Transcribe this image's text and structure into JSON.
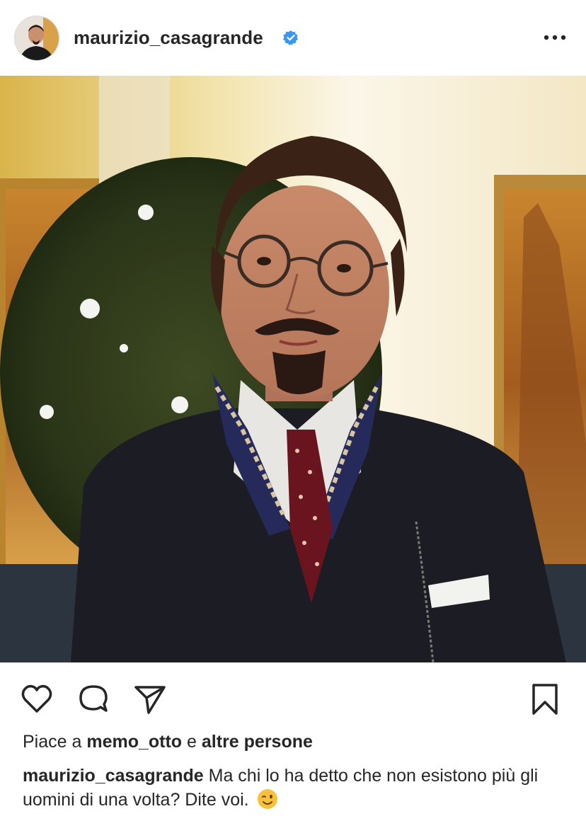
{
  "post": {
    "username": "maurizio_casagrande",
    "verified": true,
    "more_icon": "more-horizontal-icon"
  },
  "actions": {
    "like_icon": "heart-icon",
    "comment_icon": "comment-icon",
    "share_icon": "send-icon",
    "save_icon": "bookmark-icon"
  },
  "likes": {
    "prefix": "Piace a",
    "user": "memo_otto",
    "connector": "e",
    "others": "altre persone"
  },
  "caption": {
    "username": "maurizio_casagrande",
    "text": "Ma chi lo ha detto che non esistono più gli uomini di una volta? Dite voi.",
    "emoji": "😉"
  },
  "colors": {
    "verified_badge": "#3897f0",
    "text": "#262626"
  }
}
